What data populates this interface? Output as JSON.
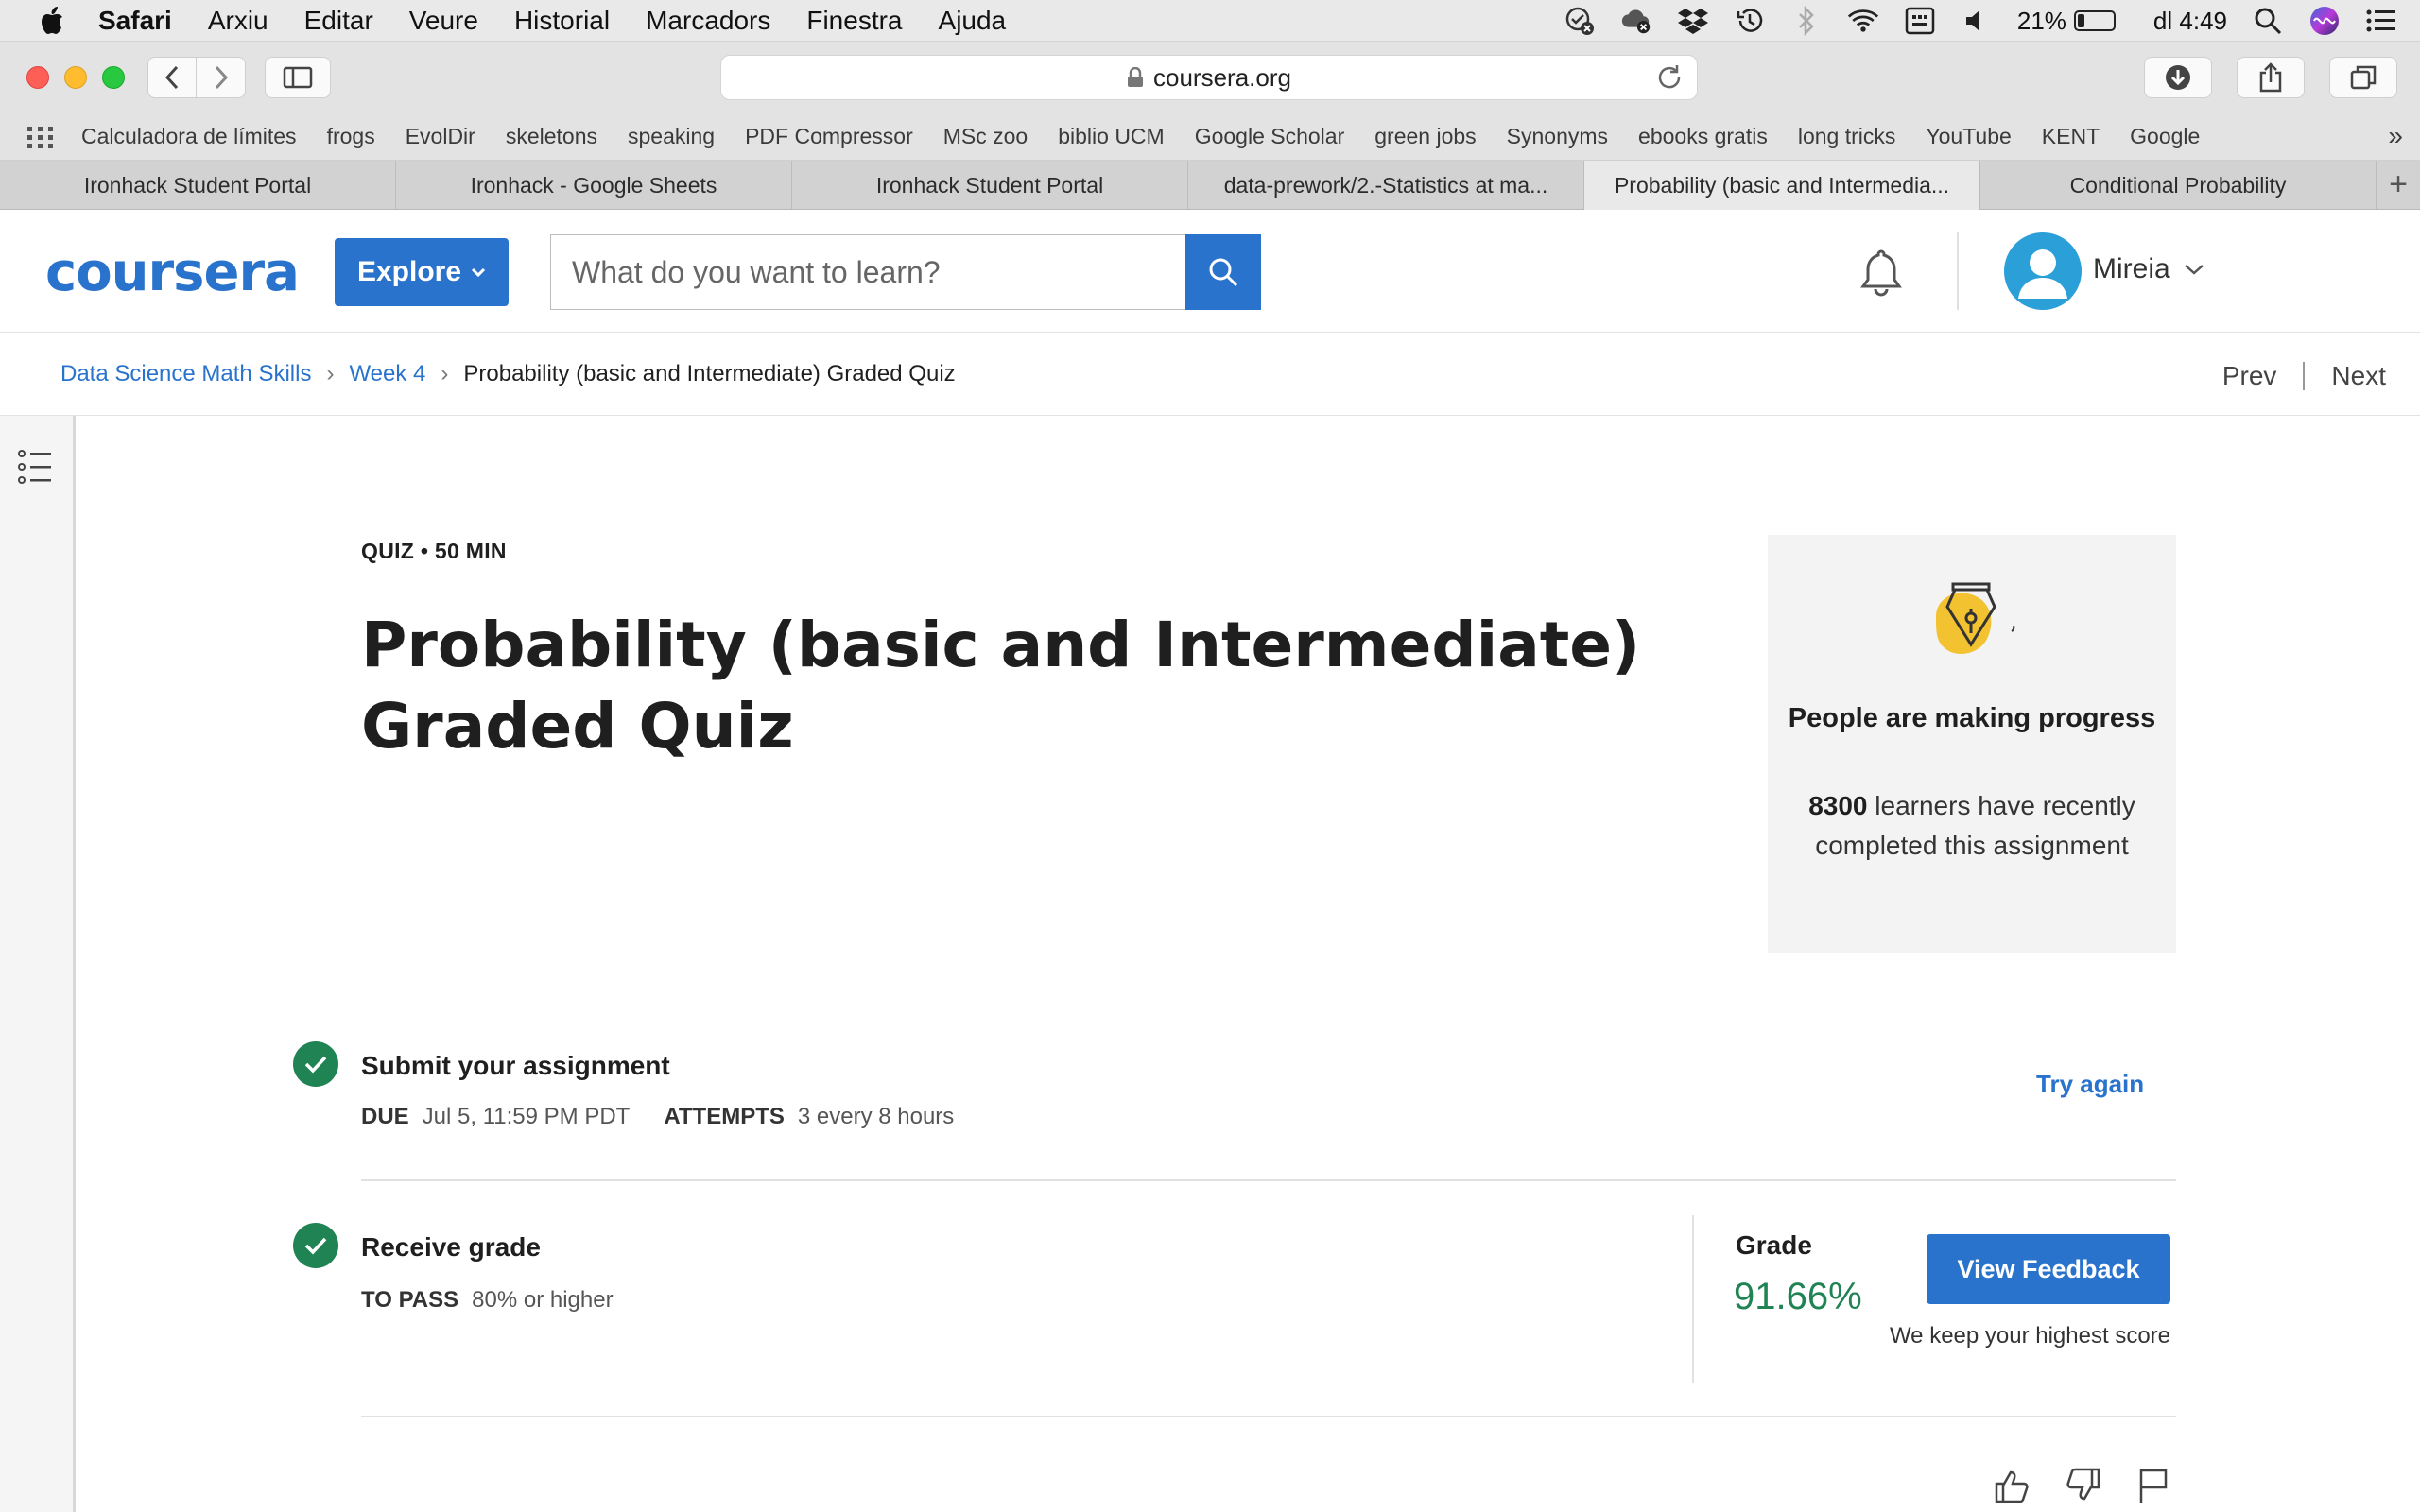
{
  "menubar": {
    "app_name": "Safari",
    "menus": [
      "Arxiu",
      "Editar",
      "Veure",
      "Historial",
      "Marcadors",
      "Finestra",
      "Ajuda"
    ],
    "battery_percent": "21%",
    "battery_level": 0.21,
    "clock": "dl 4:49",
    "status_icons": [
      "checkmark-sync-icon",
      "cloud-icon",
      "dropbox-icon",
      "time-machine-icon",
      "bluetooth-icon",
      "wifi-icon",
      "keyboard-icon",
      "volume-icon",
      "spotlight-icon",
      "siri-icon",
      "notification-center-icon"
    ]
  },
  "toolbar": {
    "url": "coursera.org"
  },
  "bookmarks": [
    "Calculadora de límites",
    "frogs",
    "EvolDir",
    "skeletons",
    "speaking",
    "PDF Compressor",
    "MSc zoo",
    "biblio UCM",
    "Google Scholar",
    "green jobs",
    "Synonyms",
    "ebooks gratis",
    "long tricks",
    "YouTube",
    "KENT",
    "Google"
  ],
  "tabs": [
    {
      "label": "Ironhack Student Portal",
      "active": false
    },
    {
      "label": "Ironhack - Google Sheets",
      "active": false
    },
    {
      "label": "Ironhack Student Portal",
      "active": false
    },
    {
      "label": "data-prework/2.-Statistics at ma...",
      "active": false
    },
    {
      "label": "Probability (basic and Intermedia...",
      "active": true
    },
    {
      "label": "Conditional Probability",
      "active": false
    }
  ],
  "header": {
    "logo": "coursera",
    "explore_label": "Explore",
    "search_placeholder": "What do you want to learn?",
    "user_name": "Mireia"
  },
  "breadcrumb": {
    "items": [
      "Data Science Math Skills",
      "Week 4"
    ],
    "current": "Probability (basic and Intermediate) Graded Quiz",
    "prev": "Prev",
    "next": "Next"
  },
  "quiz": {
    "meta": "QUIZ • 50 MIN",
    "title": "Probability (basic and Intermediate) Graded Quiz"
  },
  "progress_card": {
    "title": "People are making progress",
    "count": "8300",
    "text": "learners have recently completed this assignment"
  },
  "submit": {
    "title": "Submit your assignment",
    "due_label": "DUE",
    "due_value": "Jul 5, 11:59 PM PDT",
    "attempts_label": "ATTEMPTS",
    "attempts_value": "3 every 8 hours",
    "action": "Try again"
  },
  "grade_section": {
    "title": "Receive grade",
    "pass_label": "TO PASS",
    "pass_value": "80% or higher",
    "grade_label": "Grade",
    "grade_value": "91.66%",
    "button": "View Feedback",
    "note": "We keep your highest score"
  },
  "colors": {
    "brand_blue": "#2a73cc",
    "success_green": "#1f8354",
    "card_bg": "#f3f3f3"
  }
}
